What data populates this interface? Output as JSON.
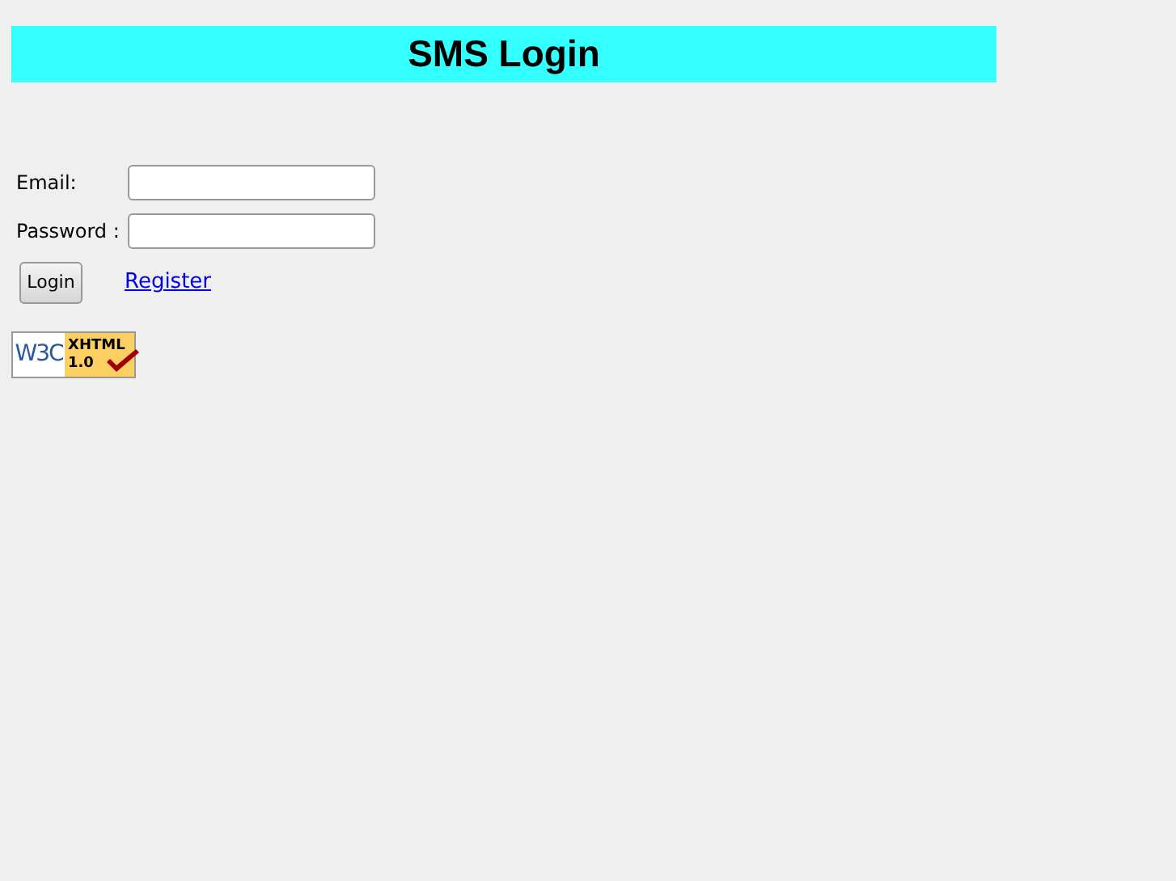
{
  "header": {
    "title": "SMS Login"
  },
  "form": {
    "fields": [
      {
        "label": "Email:"
      },
      {
        "label": "Password :"
      }
    ],
    "login_button": "Login",
    "register_link": "Register"
  },
  "badge": {
    "logo": "W3C",
    "name": "XHTML",
    "version": "1.0"
  }
}
